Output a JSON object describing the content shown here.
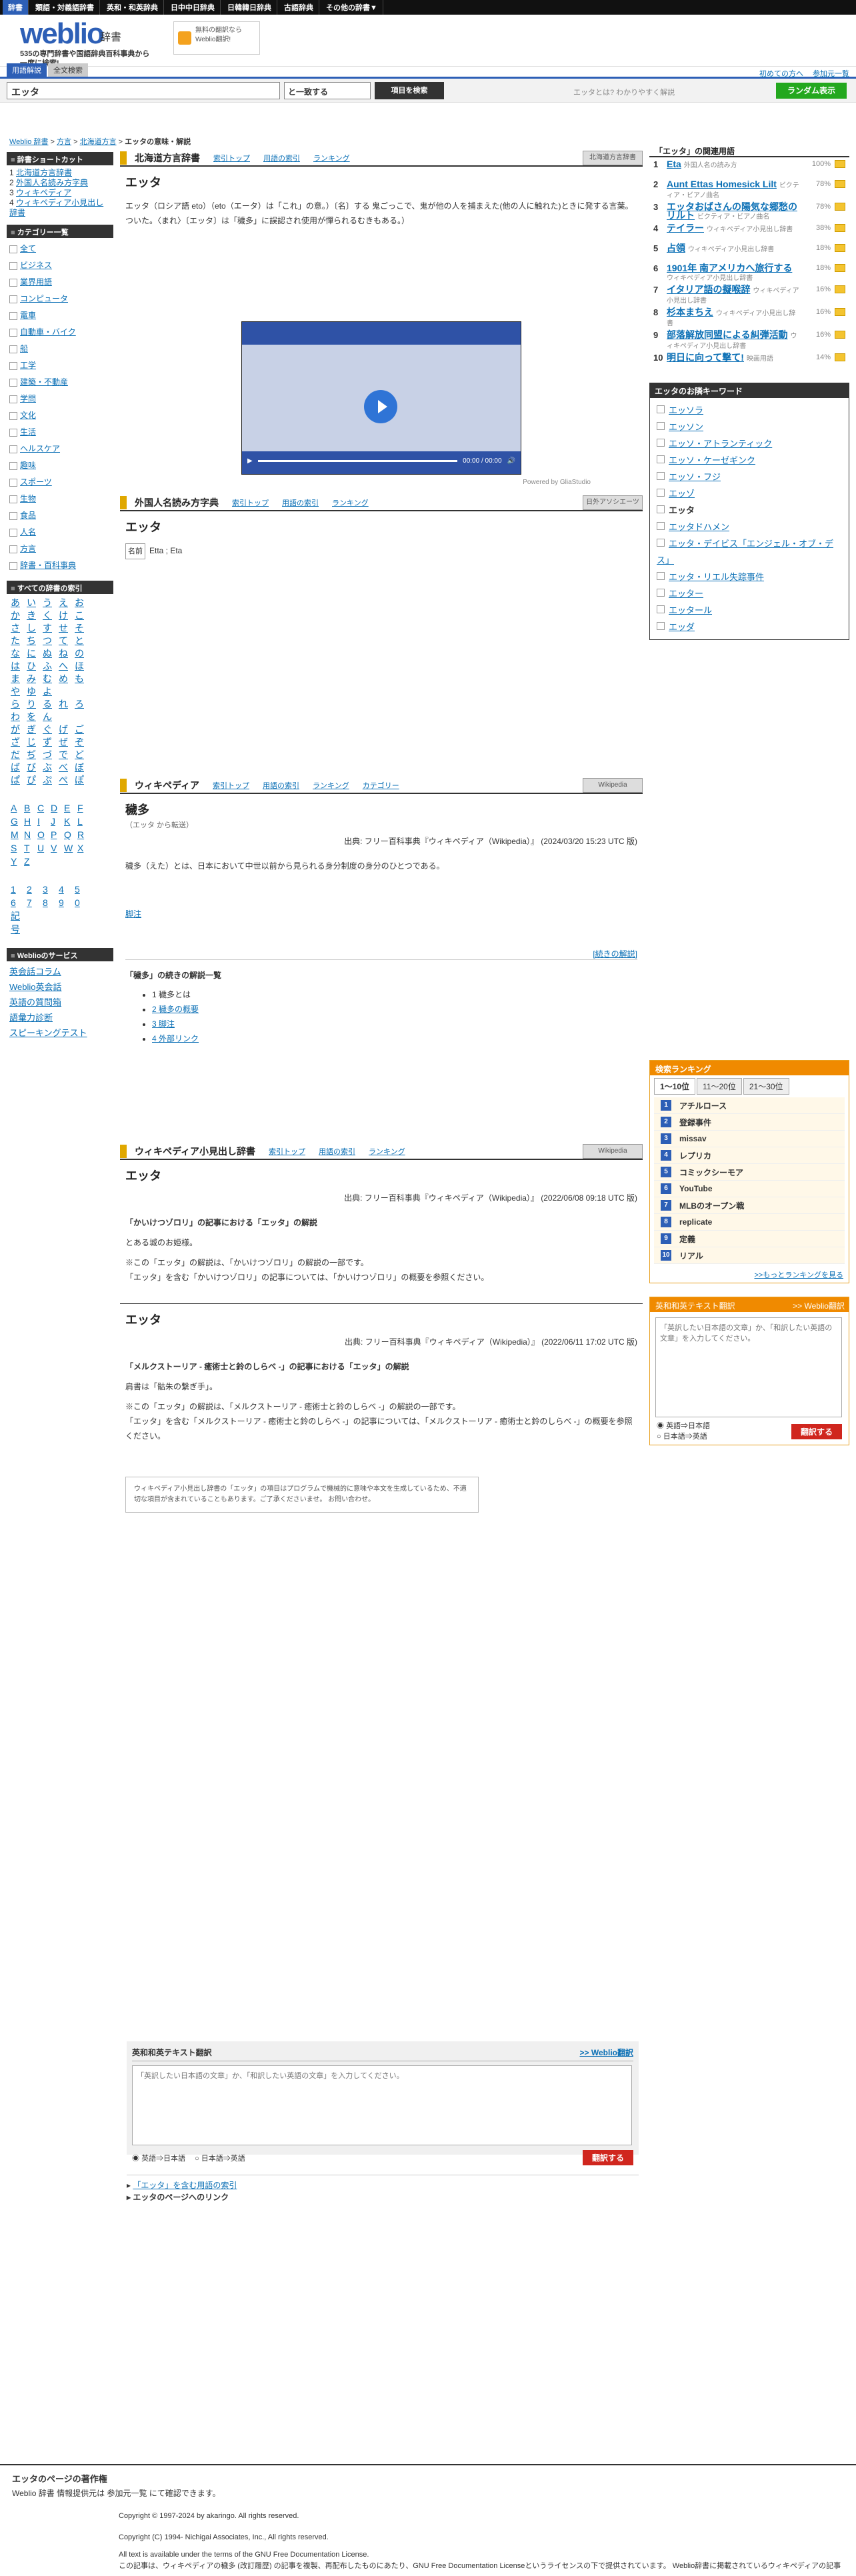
{
  "topbar": {
    "items": [
      "辞書",
      "類語・対義語辞書",
      "英和・和英辞典",
      "日中中日辞典",
      "日韓韓日辞典",
      "古語辞典",
      "その他の辞書▼"
    ],
    "right": [
      "Weblio 辞書",
      "ヘルプ"
    ]
  },
  "header": {
    "logo": "weblio",
    "logo_sub": "辞書",
    "tagline": "535の専門辞書や国語辞典百科事典から一度に検索!",
    "promo": "無料の翻訳なら Weblio翻訳!"
  },
  "tabs": {
    "items": [
      "用語解説",
      "全文検索"
    ],
    "links": [
      "初めての方へ",
      "参加元一覧"
    ]
  },
  "search": {
    "value": "エッタ",
    "mode": "と一致する",
    "button": "項目を検索",
    "hint": "エッタとは? わかりやすく解説",
    "random": "ランダム表示"
  },
  "breadcrumb": {
    "items": [
      "Weblio 辞書",
      "方言",
      "北海道方言"
    ],
    "current": "エッタの意味・解説"
  },
  "sidebar": {
    "shortcut_title": "辞書ショートカット",
    "shortcuts": [
      "北海道方言辞書",
      "外国人名読み方字典",
      "ウィキペディア",
      "ウィキペディア小見出し辞書"
    ],
    "category_title": "カテゴリー一覧",
    "categories": [
      "全て",
      "ビジネス",
      "業界用語",
      "コンピュータ",
      "電車",
      "自動車・バイク",
      "船",
      "工学",
      "建築・不動産",
      "学問",
      "文化",
      "生活",
      "ヘルスケア",
      "趣味",
      "スポーツ",
      "生物",
      "食品",
      "人名",
      "方言",
      "辞書・百科事典"
    ],
    "index_title": "すべての辞書の索引",
    "kana": [
      "あ",
      "い",
      "う",
      "え",
      "お",
      "か",
      "き",
      "く",
      "け",
      "こ",
      "さ",
      "し",
      "す",
      "せ",
      "そ",
      "た",
      "ち",
      "つ",
      "て",
      "と",
      "な",
      "に",
      "ぬ",
      "ね",
      "の",
      "は",
      "ひ",
      "ふ",
      "へ",
      "ほ",
      "ま",
      "み",
      "む",
      "め",
      "も",
      "や",
      "ゆ",
      "よ",
      "",
      "",
      "ら",
      "り",
      "る",
      "れ",
      "ろ",
      "わ",
      "を",
      "ん",
      "",
      "",
      "が",
      "ぎ",
      "ぐ",
      "げ",
      "ご",
      "ざ",
      "じ",
      "ず",
      "ぜ",
      "ぞ",
      "だ",
      "ぢ",
      "づ",
      "で",
      "ど",
      "ば",
      "び",
      "ぶ",
      "べ",
      "ぼ",
      "ぱ",
      "ぴ",
      "ぷ",
      "ぺ",
      "ぽ"
    ],
    "alpha": [
      "A",
      "B",
      "C",
      "D",
      "E",
      "F",
      "G",
      "H",
      "I",
      "J",
      "K",
      "L",
      "M",
      "N",
      "O",
      "P",
      "Q",
      "R",
      "S",
      "T",
      "U",
      "V",
      "W",
      "X",
      "Y",
      "Z"
    ],
    "nums": [
      "1",
      "2",
      "3",
      "4",
      "5",
      "6",
      "7",
      "8",
      "9",
      "0",
      "記号"
    ],
    "service_title": "Weblioのサービス",
    "services": [
      "英会話コラム",
      "Weblio英会話",
      "英語の質問箱",
      "語彙力診断",
      "スピーキングテスト"
    ]
  },
  "sec1": {
    "title": "北海道方言辞書",
    "links": [
      "索引トップ",
      "用語の索引",
      "ランキング"
    ],
    "badge": "北海道方言辞書",
    "word": "エッタ",
    "body": "エッタ（ロシア語 eto）（eto（エータ）は「これ」の意。）〔名〕する 鬼ごっこで、鬼が他の人を捕まえた(他の人に触れた)ときに発する言葉。ついた。〈まれ〉〔エッタ〕は「穢多」に誤認され使用が憚られるむきもある。）"
  },
  "video": {
    "time": "00:00 / 00:00",
    "powered": "Powered by GliaStudio"
  },
  "sec2": {
    "title": "外国人名読み方字典",
    "links": [
      "索引トップ",
      "用語の索引",
      "ランキング"
    ],
    "badge": "日外アソシエーツ",
    "word": "エッタ",
    "tag": "名前",
    "body": "Etta ; Eta"
  },
  "sec3": {
    "title": "ウィキペディア",
    "links": [
      "索引トップ",
      "用語の索引",
      "ランキング",
      "カテゴリー"
    ],
    "badge": "Wikipedia",
    "word": "穢多",
    "redirect": "（エッタ から転送）",
    "meta": "出典: フリー百科事典『ウィキペディア（Wikipedia）』 (2024/03/20 15:23 UTC 版)",
    "body": "穢多（えた）とは、日本において中世以前から見られる身分制度の身分のひとつである。",
    "footnote": "脚注",
    "more": "[続きの解説]",
    "cont_title": "「穢多」の続きの解説一覧",
    "cont": [
      "1 穢多とは",
      "2 穢多の概要",
      "3 脚注",
      "4 外部リンク"
    ]
  },
  "sec4": {
    "title": "ウィキペディア小見出し辞書",
    "links": [
      "索引トップ",
      "用語の索引",
      "ランキング"
    ],
    "badge": "Wikipedia",
    "e1": {
      "word": "エッタ",
      "meta": "出典: フリー百科事典『ウィキペディア（Wikipedia）』 (2022/06/08 09:18 UTC 版)",
      "sub": "「かいけつゾロリ」の記事における「エッタ」の解説",
      "p1": "とある城のお姫様。",
      "p2": "※この「エッタ」の解説は、「かいけつゾロリ」の解説の一部です。",
      "p3": "「エッタ」を含む「かいけつゾロリ」の記事については、「かいけつゾロリ」の概要を参照ください。"
    },
    "e2": {
      "word": "エッタ",
      "meta": "出典: フリー百科事典『ウィキペディア（Wikipedia）』 (2022/06/11 17:02 UTC 版)",
      "sub": "「メルクストーリア - 癒術士と鈴のしらべ -」の記事における「エッタ」の解説",
      "p1": "肩書は「骷朱の繋ぎ手」。",
      "p2": "※この「エッタ」の解説は、「メルクストーリア - 癒術士と鈴のしらべ -」の解説の一部です。",
      "p3": "「エッタ」を含む「メルクストーリア - 癒術士と鈴のしらべ -」の記事については、「メルクストーリア - 癒術士と鈴のしらべ -」の概要を参照ください。"
    },
    "note": "ウィキペディア小見出し辞書の「エッタ」の項目はプログラムで機械的に意味や本文を生成しているため、不適切な項目が含まれていることもあります。ご了承くださいませ。 お問い合わせ。"
  },
  "related": {
    "title": "「エッタ」の関連用語",
    "items": [
      {
        "n": "1",
        "t": "Eta",
        "s": "外国人名の読み方",
        "p": "100%"
      },
      {
        "n": "2",
        "t": "Aunt Ettas Homesick Lilt",
        "s": "ビクティア・ビアノ曲名",
        "p": "78%"
      },
      {
        "n": "3",
        "t": "エッタおばさんの陽気な郷愁のリルト",
        "s": "ビクティア・ビアノ曲名",
        "p": "78%"
      },
      {
        "n": "4",
        "t": "テイラー",
        "s": "ウィキペディア小見出し辞書",
        "p": "38%"
      },
      {
        "n": "5",
        "t": "占領",
        "s": "ウィキペディア小見出し辞書",
        "p": "18%"
      },
      {
        "n": "6",
        "t": "1901年 南アメリカへ旅行する",
        "s": "ウィキペディア小見出し辞書",
        "p": "18%"
      },
      {
        "n": "7",
        "t": "イタリア語の擬喉辞",
        "s": "ウィキペディア小見出し辞書",
        "p": "16%"
      },
      {
        "n": "8",
        "t": "杉本まちえ",
        "s": "ウィキペディア小見出し辞書",
        "p": "16%"
      },
      {
        "n": "9",
        "t": "部落解放同盟による糾弾活動",
        "s": "ウィキペディア小見出し辞書",
        "p": "16%"
      },
      {
        "n": "10",
        "t": "明日に向って撃て!",
        "s": "映画用語",
        "p": "14%"
      }
    ]
  },
  "keywords": {
    "title": "エッタのお隣キーワード",
    "items": [
      "エッソラ",
      "エッソン",
      "エッソ・アトランティック",
      "エッソ・ケーゼギンク",
      "エッソ・フジ",
      "エッゾ",
      "エッタ",
      "エッタドハメン",
      "エッタ・デイビス「エンジェル・オブ・デス」",
      "エッタ・リエル失踪事件",
      "エッター",
      "エッタール",
      "エッダ"
    ]
  },
  "ranking": {
    "title": "検索ランキング",
    "tabs": [
      "1〜10位",
      "11〜20位",
      "21〜30位"
    ],
    "items": [
      "アチルロース",
      "登録事件",
      "missav",
      "レプリカ",
      "コミックシーモア",
      "YouTube",
      "MLBのオープン戦",
      "replicate",
      "定義",
      "リアル"
    ],
    "more": ">>もっとランキングを見る"
  },
  "trans": {
    "title": "英和和英テキスト翻訳",
    "link": ">> Weblio翻訳",
    "placeholder": "「英訳したい日本語の文章」か、「和訳したい英語の文章」を入力してください。",
    "opt1": "英語⇒日本語",
    "opt2": "日本語⇒英語",
    "button": "翻訳する"
  },
  "bottom": {
    "links": [
      "「エッタ」を含む用語の索引",
      "エッタのページへのリンク"
    ]
  },
  "footer": {
    "title": "エッタのページの著作権",
    "line": "Weblio 辞書 情報提供元は 参加元一覧 にて確認できます。",
    "c1": "Copyright © 1997-2024 by akaringo. All rights reserved.",
    "c2": "Copyright (C) 1994- Nichigai Associates, Inc., All rights reserved.",
    "c3": "All text is available under the terms of the GNU Free Documentation License.",
    "c4": "この記事は、ウィキペディアの穢多 (改訂履歴) の記事を複製、再配布したものにあたり、GNU Free Documentation Licenseというライセンスの下で提供されています。 Weblio辞書に掲載されているウィキペディアの記事も、全てGNU Free Documentation Licenseの元に提供されております。"
  }
}
